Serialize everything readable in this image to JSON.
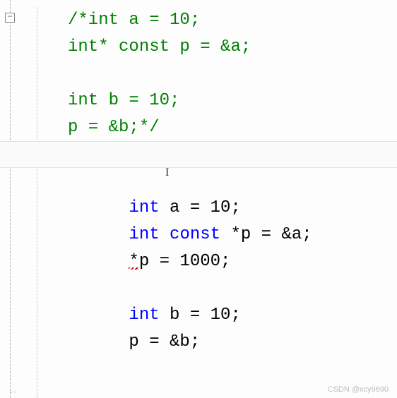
{
  "gutter": {
    "fold_symbol": "−"
  },
  "code": {
    "commented": {
      "l1": "/*int a = 10;",
      "l2": "int* const p = &a;",
      "l3": "",
      "l4": "int b = 10;",
      "l5": "p = &b;*/"
    },
    "active": {
      "l1_kw": "int",
      "l1_rest": " a = 10;",
      "l2_kw1": "int",
      "l2_kw2": " const ",
      "l2_rest": "*p = &a;",
      "l3_star": "*",
      "l3_p": "p",
      "l3_rest": " = 1000;",
      "l4_kw": "int",
      "l4_rest": " b = 10;",
      "l5": "p = &b;"
    }
  },
  "icons": {
    "text_cursor": "I"
  },
  "watermark": "CSDN @xcy9690"
}
